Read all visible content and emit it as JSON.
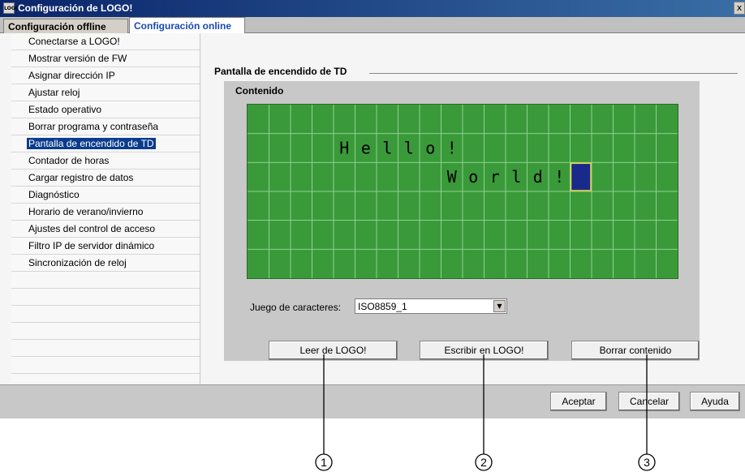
{
  "window": {
    "title": "Configuración de LOGO!",
    "app_icon_text": "LOGO",
    "close_label": "x"
  },
  "tabs": [
    {
      "label": "Configuración offline"
    },
    {
      "label": "Configuración online"
    }
  ],
  "nav": {
    "items": [
      {
        "label": "Conectarse a LOGO!"
      },
      {
        "label": "Mostrar versión de FW"
      },
      {
        "label": "Asignar dirección IP"
      },
      {
        "label": "Ajustar reloj"
      },
      {
        "label": "Estado operativo"
      },
      {
        "label": "Borrar programa y contraseña"
      },
      {
        "label": "Pantalla de encendido de TD"
      },
      {
        "label": "Contador de horas"
      },
      {
        "label": "Cargar registro de datos"
      },
      {
        "label": "Diagnóstico"
      },
      {
        "label": "Horario de verano/invierno"
      },
      {
        "label": "Ajustes del control de acceso"
      },
      {
        "label": "Filtro IP de servidor dinámico"
      },
      {
        "label": "Sincronización de reloj"
      }
    ],
    "selected": "Pantalla de encendido de TD"
  },
  "panel": {
    "title": "Pantalla de encendido de TD",
    "group_title": "Contenido",
    "lcd_line2": "Hello!",
    "lcd_line3": "World!",
    "charset_label": "Juego de caracteres:",
    "charset_value": "ISO8859_1",
    "read_button": "Leer de LOGO!",
    "write_button": "Escribir en LOGO!",
    "clear_button": "Borrar contenido"
  },
  "footer": {
    "ok": "Aceptar",
    "cancel": "Cancelar",
    "help": "Ayuda"
  },
  "callouts": [
    "1",
    "2",
    "3"
  ],
  "colors": {
    "lcd_bg": "#3a9a3a",
    "lcd_cursor": "#1a2a8a",
    "selection": "#0a3c8c"
  }
}
